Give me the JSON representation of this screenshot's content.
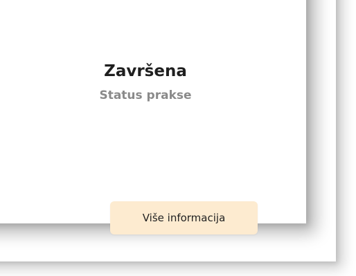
{
  "status": {
    "value": "Završena",
    "label": "Status prakse"
  },
  "actions": {
    "more_info_label": "Više informacija"
  },
  "colors": {
    "button_bg": "#fdebd0",
    "value_text": "#1f1f1f",
    "label_text": "#8a8a8a"
  }
}
